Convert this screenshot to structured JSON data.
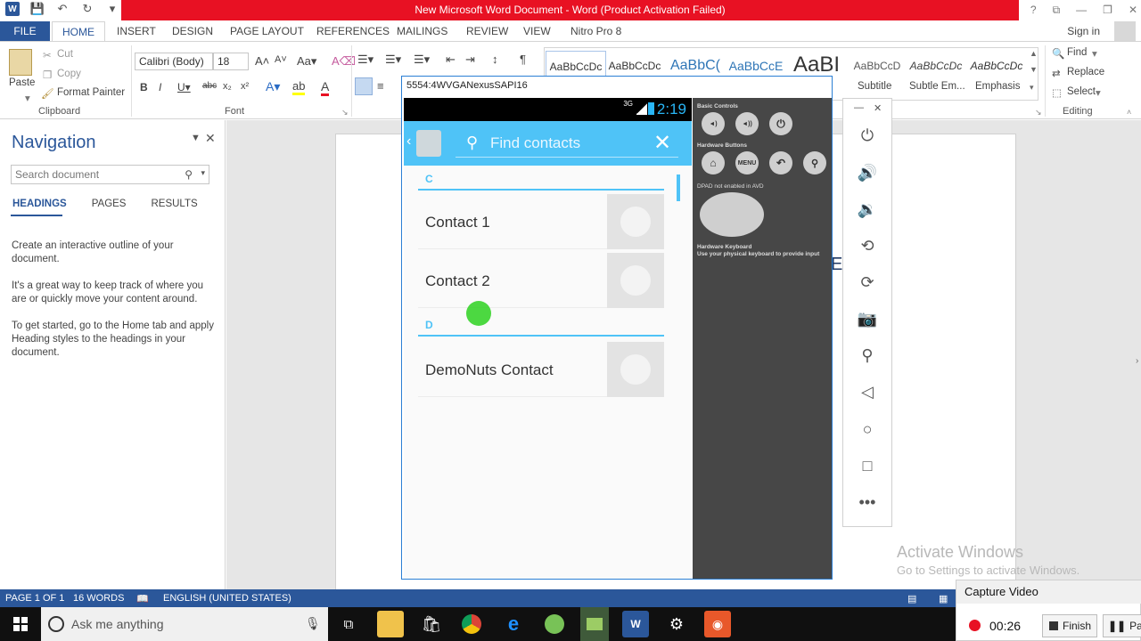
{
  "window": {
    "title": "New Microsoft Word Document - Word (Product Activation Failed)",
    "controls": [
      "?",
      "⧉",
      "—",
      "❐",
      "✕"
    ]
  },
  "tabs": [
    "FILE",
    "HOME",
    "INSERT",
    "DESIGN",
    "PAGE LAYOUT",
    "REFERENCES",
    "MAILINGS",
    "REVIEW",
    "VIEW",
    "Nitro Pro 8"
  ],
  "signin": "Sign in",
  "ribbon": {
    "clipboard": {
      "paste": "Paste",
      "cut": "Cut",
      "copy": "Copy",
      "format_painter": "Format Painter",
      "label": "Clipboard"
    },
    "font": {
      "name": "Calibri (Body)",
      "size": "18",
      "label": "Font"
    },
    "styles": {
      "tiles": [
        "AaBbCcDc",
        "AaBbCcDc",
        "AaBbC(",
        "AaBbCcE",
        "AaBI",
        "AaBbCcD",
        "AaBbCcDc",
        "AaBbCcDc"
      ],
      "names": [
        "Subtitle",
        "Subtle Em...",
        "Emphasis"
      ]
    },
    "editing": {
      "find": "Find",
      "replace": "Replace",
      "select": "Select",
      "label": "Editing"
    }
  },
  "nav": {
    "title": "Navigation",
    "search_placeholder": "Search document",
    "tabs": [
      "HEADINGS",
      "PAGES",
      "RESULTS"
    ],
    "p1": "Create an interactive outline of your document.",
    "p2": "It's a great way to keep track of where you are or quickly move your content around.",
    "p3": "To get started, go to the Home tab and apply Heading styles to the headings in your document."
  },
  "document": {
    "visible_text": "E      R"
  },
  "activation": {
    "line1": "Activate Windows",
    "line2": "Go to Settings to activate Windows."
  },
  "status": {
    "page": "PAGE 1 OF 1",
    "words": "16 WORDS",
    "language": "ENGLISH (UNITED STATES)"
  },
  "emulator": {
    "title": "5554:4WVGANexusSAPI16",
    "time": "2:19",
    "network": "3G",
    "search_placeholder": "Find contacts",
    "sections": [
      {
        "header": "C",
        "contacts": [
          "Contact 1",
          "Contact 2"
        ]
      },
      {
        "header": "D",
        "contacts": [
          "DemoNuts Contact"
        ]
      }
    ],
    "controls": {
      "basic_label": "Basic Controls",
      "hardware_label": "Hardware Buttons",
      "menu_label": "MENU",
      "dpad_label": "DPAD not enabled in AVD",
      "keyboard_label": "Hardware Keyboard",
      "keyboard_hint": "Use your physical keyboard to provide input"
    }
  },
  "taskbar": {
    "search_placeholder": "Ask me anything"
  },
  "capture": {
    "title": "Capture Video",
    "time": "00:26",
    "finish": "Finish",
    "pause": "Pause"
  },
  "colors": {
    "word_blue": "#2b579a",
    "title_red": "#e81123",
    "android_blue": "#4fc3f7"
  }
}
